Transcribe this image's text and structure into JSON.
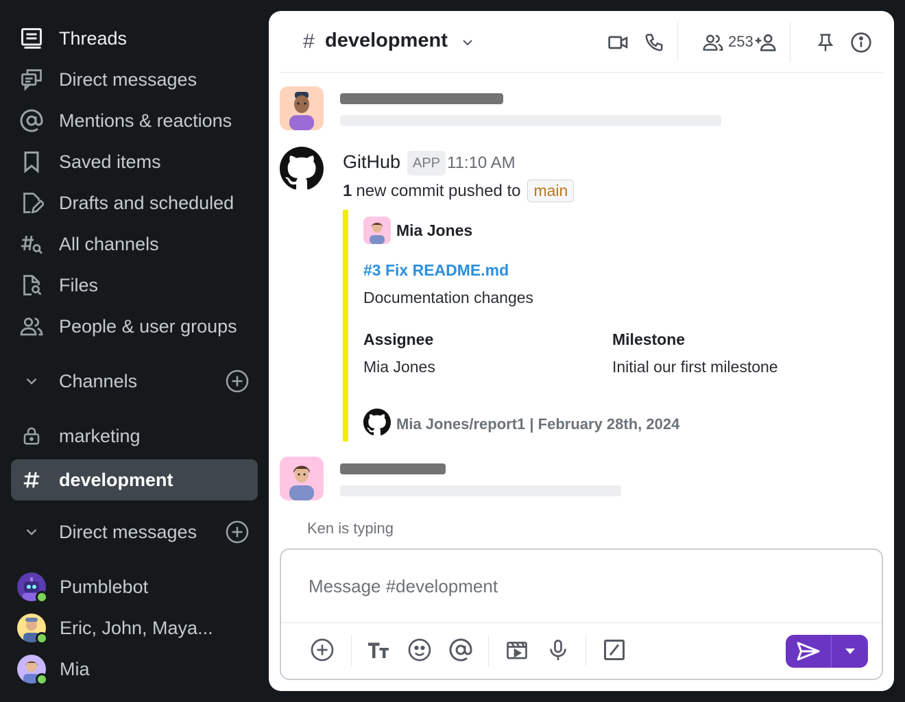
{
  "sidebar": {
    "nav": [
      {
        "label": "Threads",
        "icon": "threads-icon"
      },
      {
        "label": "Direct messages",
        "icon": "direct-messages-icon"
      },
      {
        "label": "Mentions & reactions",
        "icon": "at-sign-icon"
      },
      {
        "label": "Saved items",
        "icon": "bookmark-icon"
      },
      {
        "label": "Drafts and scheduled",
        "icon": "draft-pencil-icon"
      },
      {
        "label": "All channels",
        "icon": "channel-search-icon"
      },
      {
        "label": "Files",
        "icon": "file-search-icon"
      },
      {
        "label": "People & user groups",
        "icon": "people-icon"
      }
    ],
    "channels_header": "Channels",
    "channels": [
      {
        "label": "marketing",
        "icon": "lock-icon"
      },
      {
        "label": "development",
        "icon": "hash-icon",
        "active": true
      }
    ],
    "dms_header": "Direct messages",
    "dms": [
      {
        "label": "Pumblebot",
        "status": "online"
      },
      {
        "label": "Eric, John, Maya...",
        "status": "online"
      },
      {
        "label": "Mia",
        "status": "online"
      }
    ]
  },
  "header": {
    "hash": "#",
    "channel_name": "development",
    "member_count": "253"
  },
  "messages": {
    "github": {
      "sender": "GitHub",
      "badge": "APP",
      "time": "11:10 AM",
      "commit_count": "1",
      "commit_text": "new commit pushed to",
      "branch": "main",
      "attachment": {
        "author": "Mia Jones",
        "link": "#3 Fix README.md",
        "description": "Documentation changes",
        "fields": [
          {
            "title": "Assignee",
            "value": "Mia Jones"
          },
          {
            "title": "Milestone",
            "value": "Initial our first milestone"
          }
        ],
        "footer": "Mia Jones/report1 | February 28th, 2024"
      }
    },
    "typing": "Ken is typing"
  },
  "composer": {
    "placeholder": "Message #development"
  },
  "colors": {
    "sidebar_bg": "#16191c",
    "active_item": "#40464d",
    "accent_send": "#6b35c4",
    "attachment_bar": "#f2ee00",
    "link": "#2b8fe0",
    "branch_text": "#b7791f",
    "online": "#7cd35a"
  }
}
